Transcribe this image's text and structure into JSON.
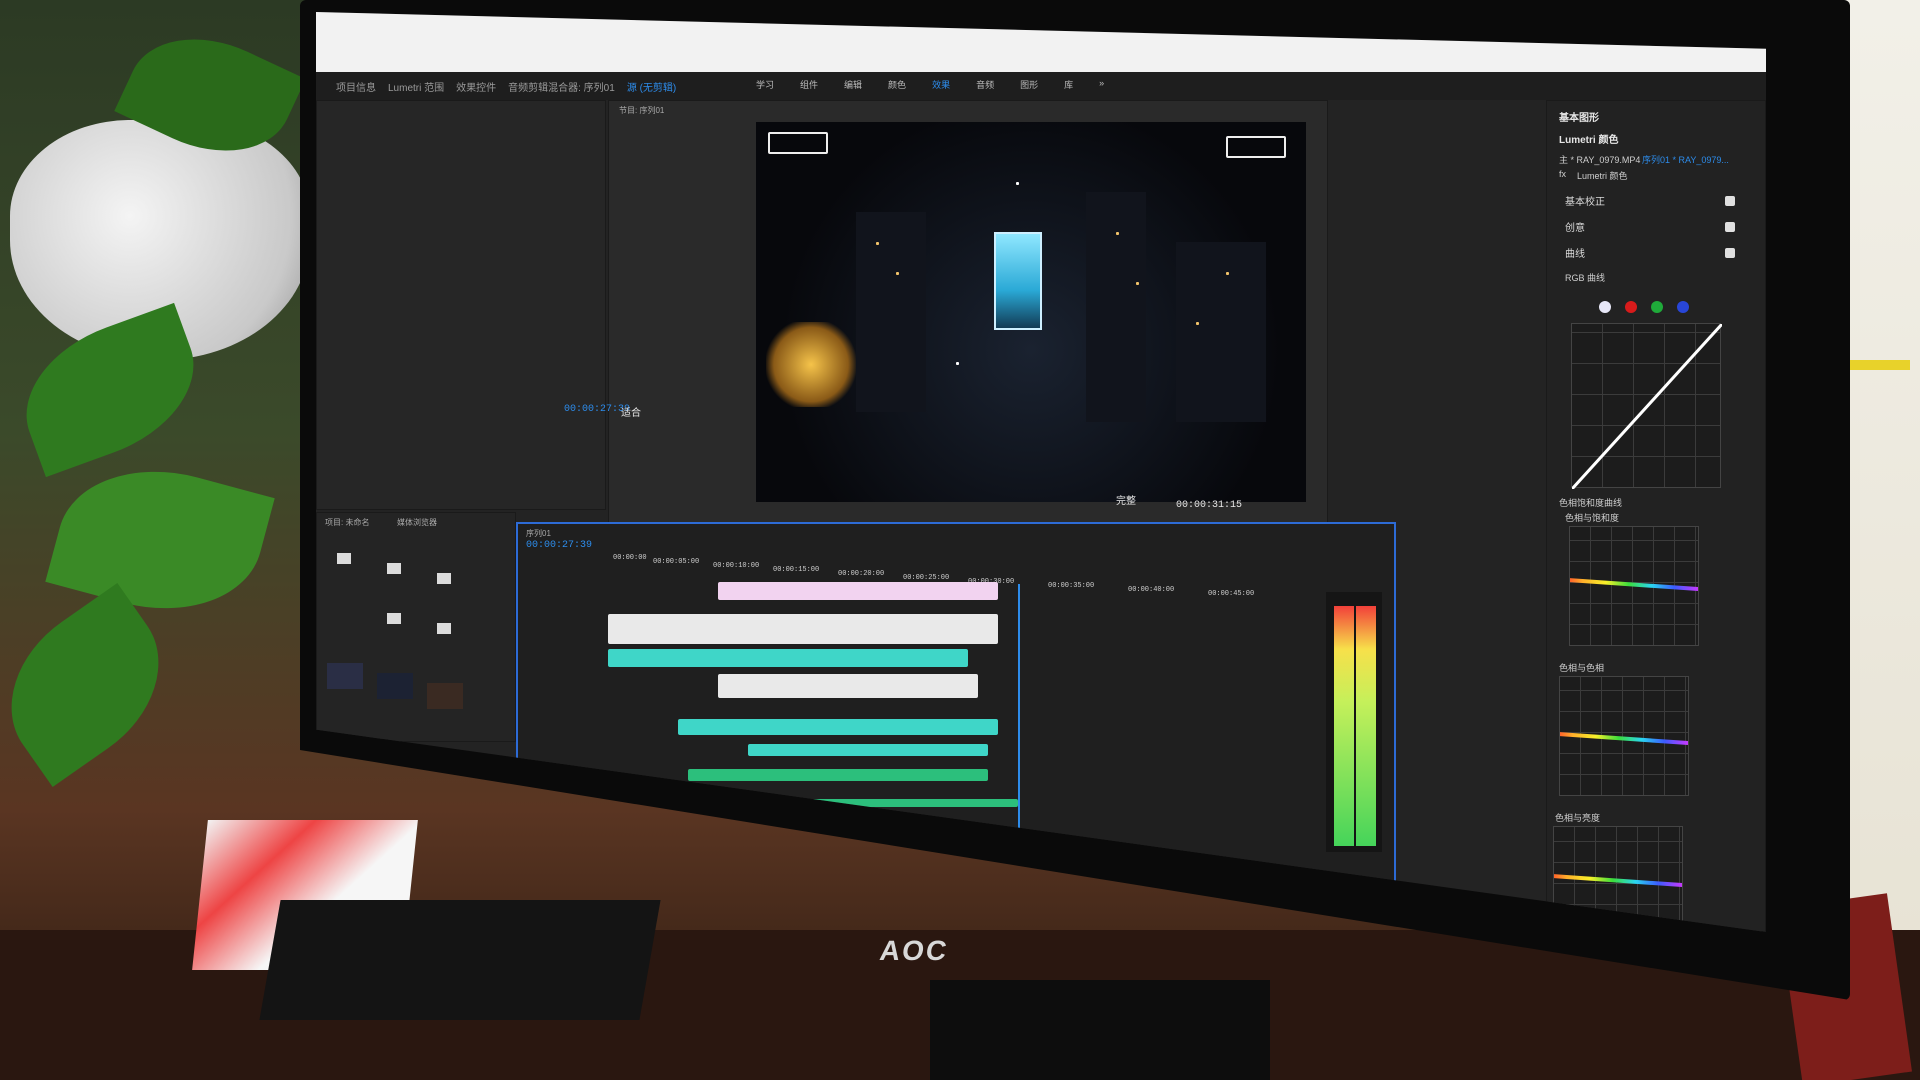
{
  "monitor": {
    "brand": "AOC"
  },
  "workspaces": {
    "left": [
      "项目信息",
      "Lumetri 范围",
      "效果控件",
      "音频剪辑混合器: 序列01",
      "源 (无剪辑)"
    ],
    "active_left": "源 (无剪辑)",
    "center": [
      "学习",
      "组件",
      "编辑",
      "颜色",
      "效果",
      "音频",
      "图形",
      "库",
      "»"
    ],
    "active_center": "效果"
  },
  "program": {
    "tab": "节目: 序列01",
    "timecode_current": "00:00:27:39",
    "fit_label": "适合",
    "timecode_end": "00:00:31:15",
    "quality": "完整"
  },
  "timeline": {
    "tab": "序列01",
    "timecode": "00:00:27:39",
    "ruler": [
      "00:00:00",
      "00:00:05:00",
      "00:00:10:00",
      "00:00:15:00",
      "00:00:20:00",
      "00:00:25:00",
      "00:00:30:00",
      "00:00:35:00",
      "00:00:40:00",
      "00:00:45:00"
    ]
  },
  "project": {
    "tab": "项目: 未命名",
    "sub_tab": "媒体浏览器"
  },
  "lumetri": {
    "panel_title": "基本图形",
    "tab": "Lumetri 颜色",
    "master_clip": "主 * RAY_0979.MP4",
    "sequence_clip": "序列01 * RAY_0979...",
    "fx_label": "fx",
    "effect_dropdown": "Lumetri 颜色",
    "sections": [
      "基本校正",
      "创意",
      "曲线"
    ],
    "rgb_curve_label": "RGB 曲线",
    "hue_sat_label": "色相饱和度曲线",
    "hue_vs_sat": "色相与饱和度",
    "hue_vs_hue": "色相与色相",
    "hue_vs_luma": "色相与亮度"
  },
  "colors": {
    "accent": "#2d8ceb",
    "timeline_border": "#2d6bd6",
    "clip_cyan": "#3fd6c8",
    "clip_green": "#2cbf7c"
  }
}
